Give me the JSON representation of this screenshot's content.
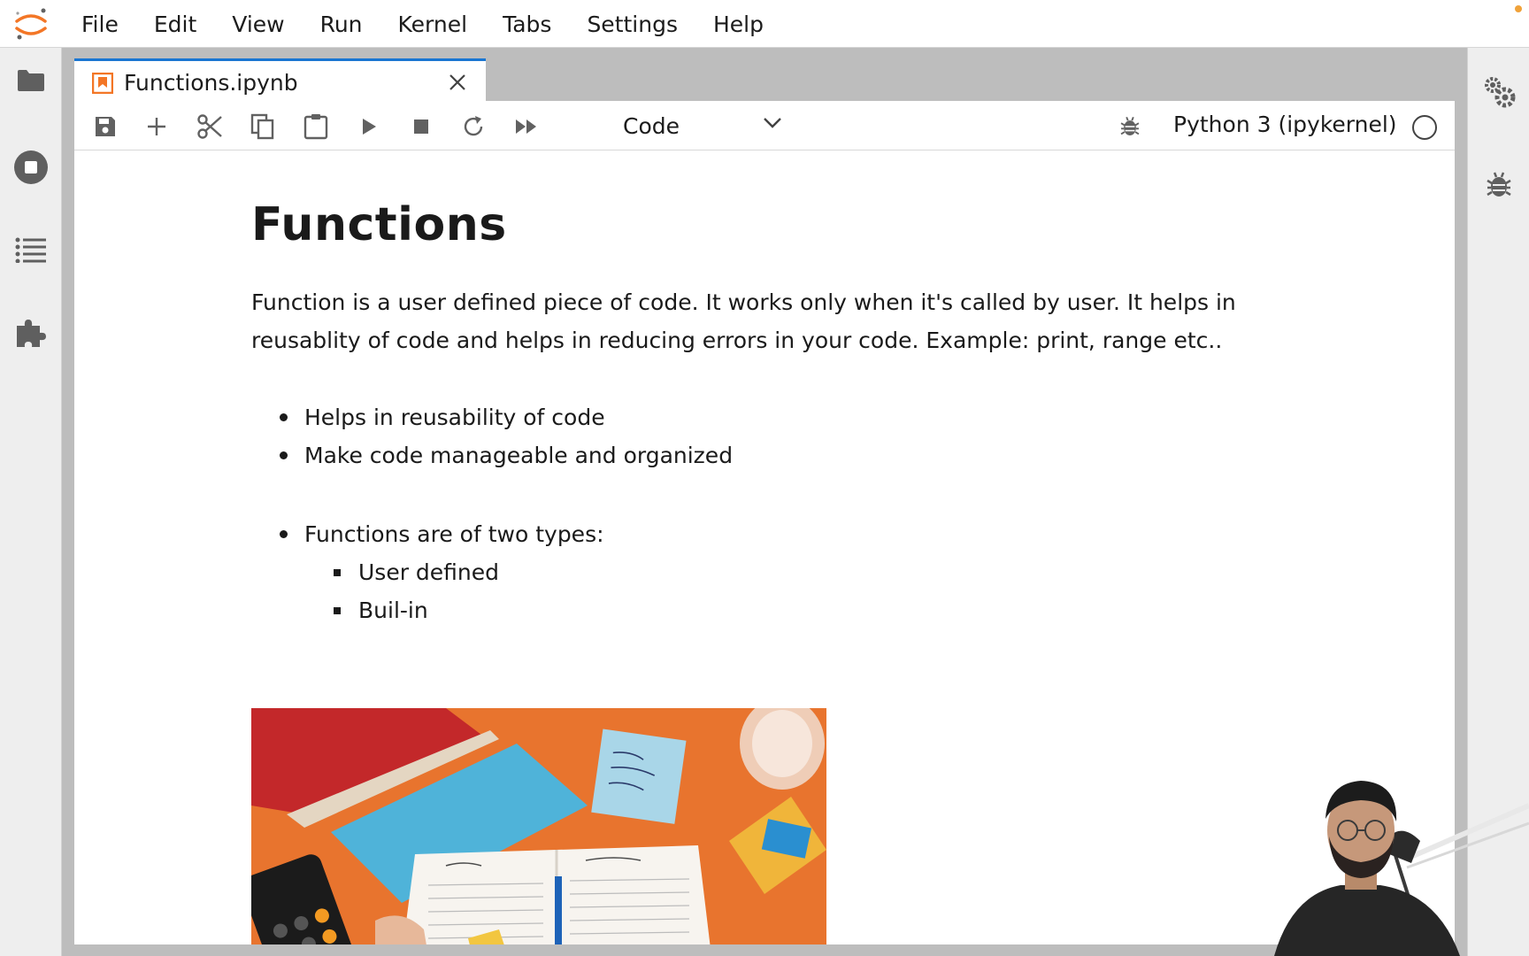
{
  "menu": {
    "items": [
      {
        "label": "File"
      },
      {
        "label": "Edit"
      },
      {
        "label": "View"
      },
      {
        "label": "Run"
      },
      {
        "label": "Kernel"
      },
      {
        "label": "Tabs"
      },
      {
        "label": "Settings"
      },
      {
        "label": "Help"
      }
    ]
  },
  "left_sidebar": {
    "icons": [
      "folder-icon",
      "running-stop-icon",
      "toc-list-icon",
      "extension-puzzle-icon"
    ]
  },
  "right_sidebar": {
    "icons": [
      "property-inspector-gears-icon",
      "debugger-bug-icon"
    ]
  },
  "tab": {
    "title": "Functions.ipynb",
    "active": true
  },
  "toolbar": {
    "buttons": [
      "save-icon",
      "add-cell-icon",
      "cut-icon",
      "copy-icon",
      "paste-icon",
      "run-icon",
      "stop-icon",
      "restart-icon",
      "run-all-icon"
    ],
    "cell_type": "Code",
    "kernel": "Python 3 (ipykernel)"
  },
  "notebook": {
    "heading": "Functions",
    "paragraph": "Function is a user defined piece of code. It works only when it's called by user. It helps in reusablity of code and helps in reducing errors in your code. Example: print, range etc..",
    "list1": [
      "Helps in reusability of code",
      "Make code manageable and organized"
    ],
    "list2_item": "Functions are of two types:",
    "list2_sub": [
      "User defined",
      "Buil-in"
    ]
  },
  "colors": {
    "accent": "#1976d2",
    "notebook_icon": "#f37626",
    "background": "#eeeeee"
  }
}
